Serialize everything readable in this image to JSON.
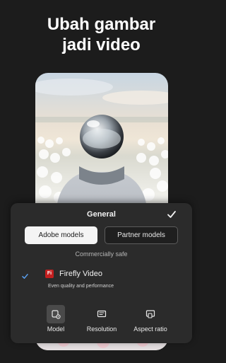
{
  "headline": {
    "line1": "Ubah gambar",
    "line2": "jadi video"
  },
  "panel": {
    "title": "General",
    "segments": {
      "adobe": "Adobe models",
      "partner": "Partner models"
    },
    "safe_label": "Commercially safe",
    "model": {
      "logo_text": "Fi",
      "name": "Firefly Video",
      "description": "Even quality and performance"
    },
    "tabs": [
      {
        "label": "Model",
        "icon": "model-icon"
      },
      {
        "label": "Resolution",
        "icon": "resolution-icon"
      },
      {
        "label": "Aspect ratio",
        "icon": "aspect-ratio-icon"
      }
    ]
  },
  "colors": {
    "background": "#1c1c1c",
    "panel": "#2b2b2b",
    "firefly_red": "#c41f1f",
    "selected_segment": "#f4f4f4"
  }
}
